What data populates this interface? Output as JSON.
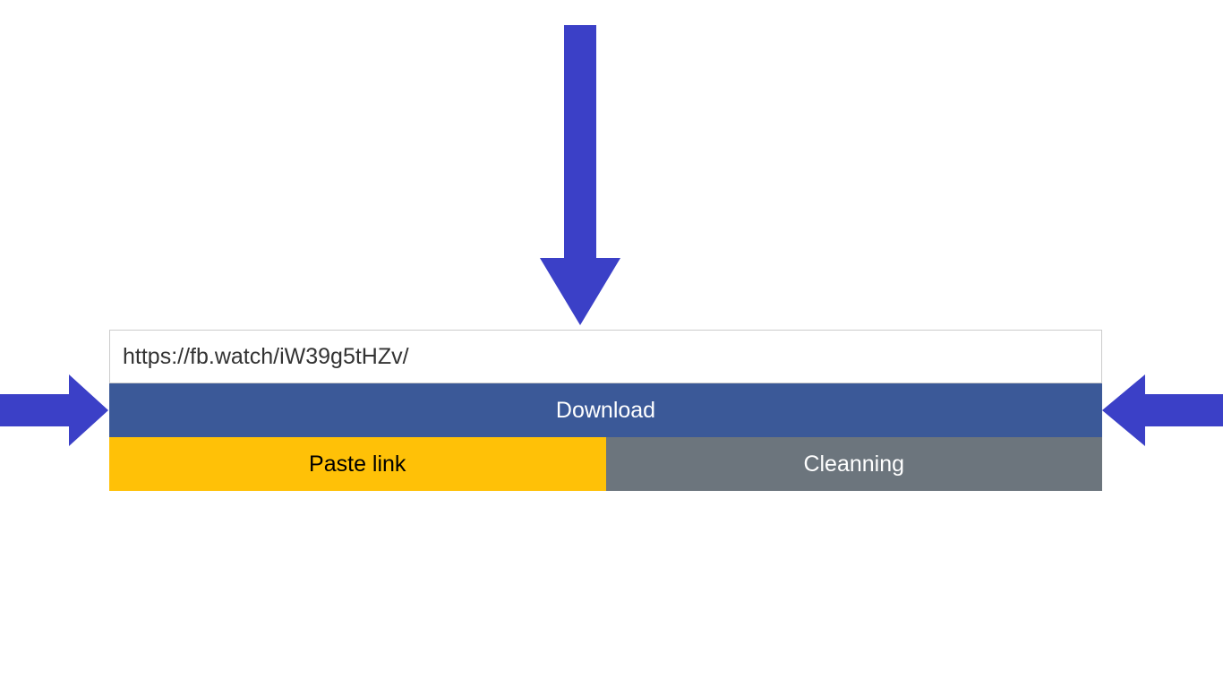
{
  "input": {
    "value": "https://fb.watch/iW39g5tHZv/",
    "placeholder": ""
  },
  "buttons": {
    "download": "Download",
    "paste": "Paste link",
    "clean": "Cleanning"
  },
  "colors": {
    "arrow": "#3b40c7",
    "download_bg": "#3b5998",
    "paste_bg": "#ffc107",
    "clean_bg": "#6c757d"
  }
}
